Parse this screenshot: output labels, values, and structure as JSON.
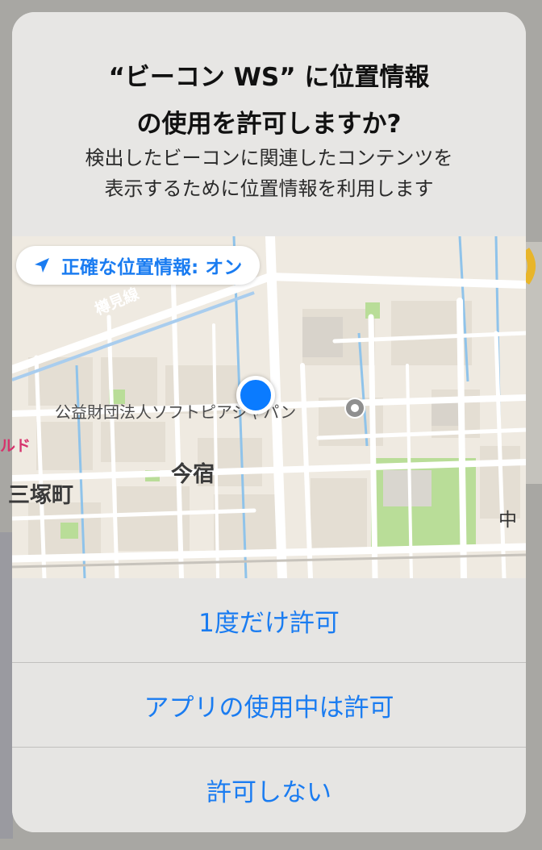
{
  "alert": {
    "title_line1": "“ビーコン WS” に位置情報",
    "title_line2": "の使用を許可しますか?",
    "message_line1": "検出したビーコンに関連したコンテンツを",
    "message_line2": "表示するために位置情報を利用します"
  },
  "map": {
    "precise_location_label": "正確な位置情報: オン",
    "labels": {
      "imajuku": "今宿",
      "mitsuka": "三塚町",
      "softopia": "公益財団法人ソフトピアジャパン",
      "rudo": "ルド",
      "naka": "中",
      "tarumi_line": "樽見線"
    }
  },
  "buttons": {
    "allow_once": "1度だけ許可",
    "allow_while_using": "アプリの使用中は許可",
    "dont_allow": "許可しない"
  },
  "colors": {
    "accent": "#1a7cf1",
    "user_dot": "#0a7bff",
    "map_bg": "#efeae1",
    "park": "#b9dd98",
    "water": "#8fc3ea"
  },
  "icons": [
    "location-arrow-icon",
    "user-location-dot-icon",
    "poi-icon"
  ]
}
